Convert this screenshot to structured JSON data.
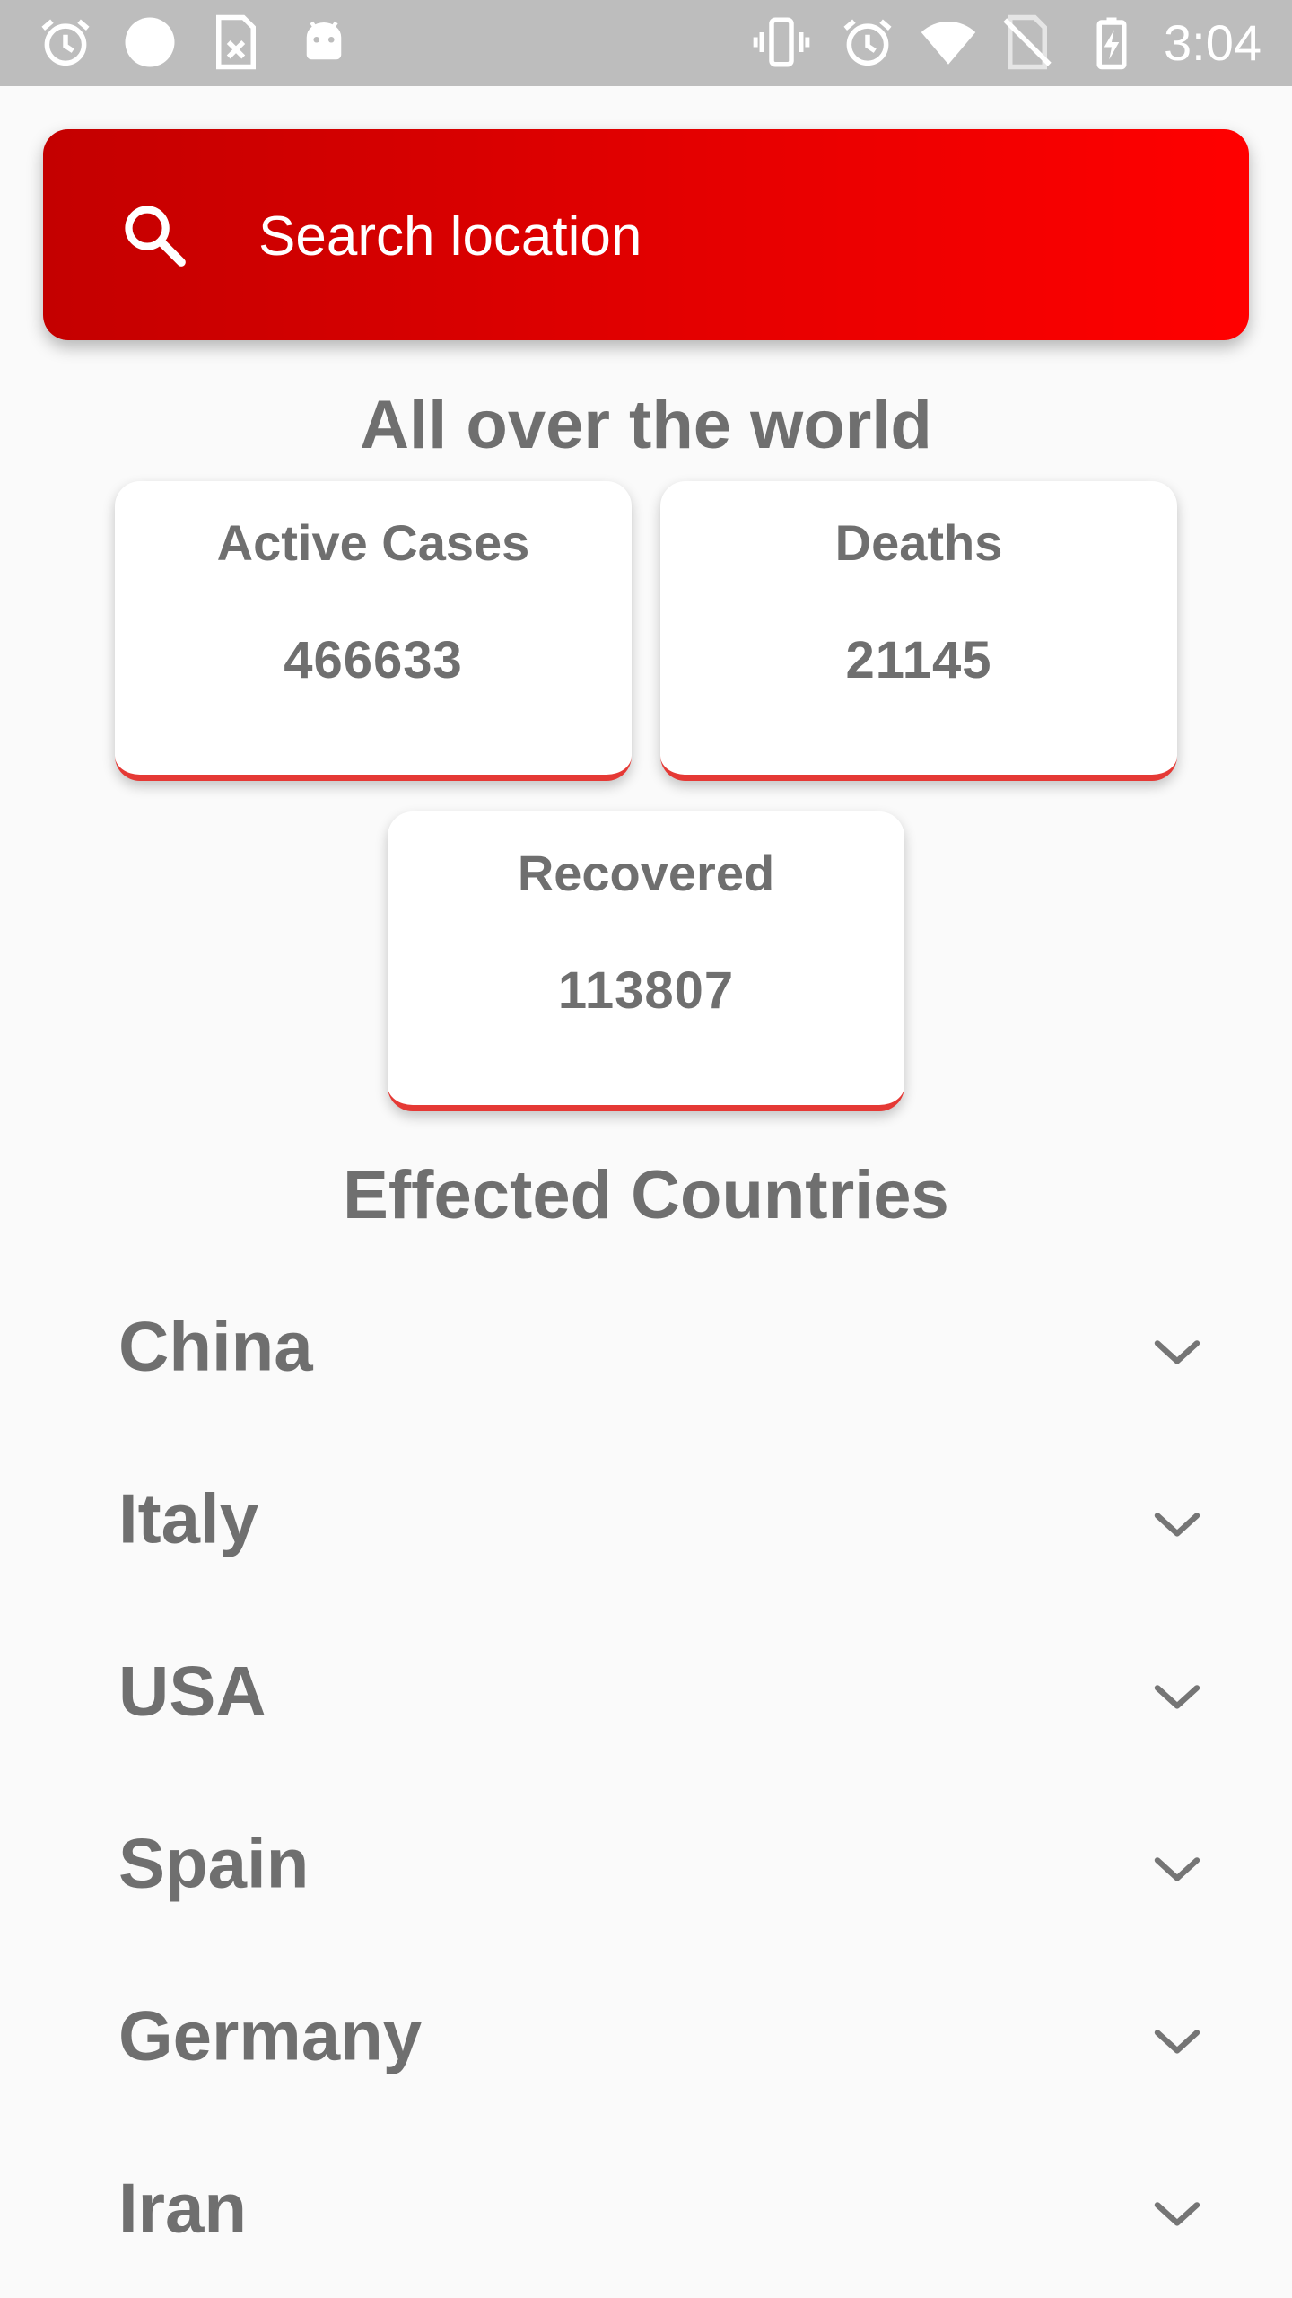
{
  "status_bar": {
    "time": "3:04",
    "left_icons": [
      "alarm-icon",
      "circle-icon",
      "sim-x-icon",
      "android-icon"
    ],
    "right_icons": [
      "vibrate-icon",
      "alarm-icon",
      "wifi-icon",
      "no-sim-icon",
      "battery-charging-icon"
    ]
  },
  "search": {
    "placeholder": "Search location",
    "icon": "search-icon"
  },
  "world": {
    "title": "All over the world",
    "active_label": "Active Cases",
    "active_value": "466633",
    "deaths_label": "Deaths",
    "deaths_value": "21145",
    "recovered_label": "Recovered",
    "recovered_value": "113807"
  },
  "countries": {
    "title": "Effected Countries",
    "items": [
      {
        "name": "China"
      },
      {
        "name": "Italy"
      },
      {
        "name": "USA"
      },
      {
        "name": "Spain"
      },
      {
        "name": "Germany"
      },
      {
        "name": "Iran"
      }
    ]
  },
  "colors": {
    "accent_red": "#e53935",
    "gradient_start": "#c40000",
    "gradient_end": "#ff0000",
    "text_gray": "#6f6f6f"
  }
}
